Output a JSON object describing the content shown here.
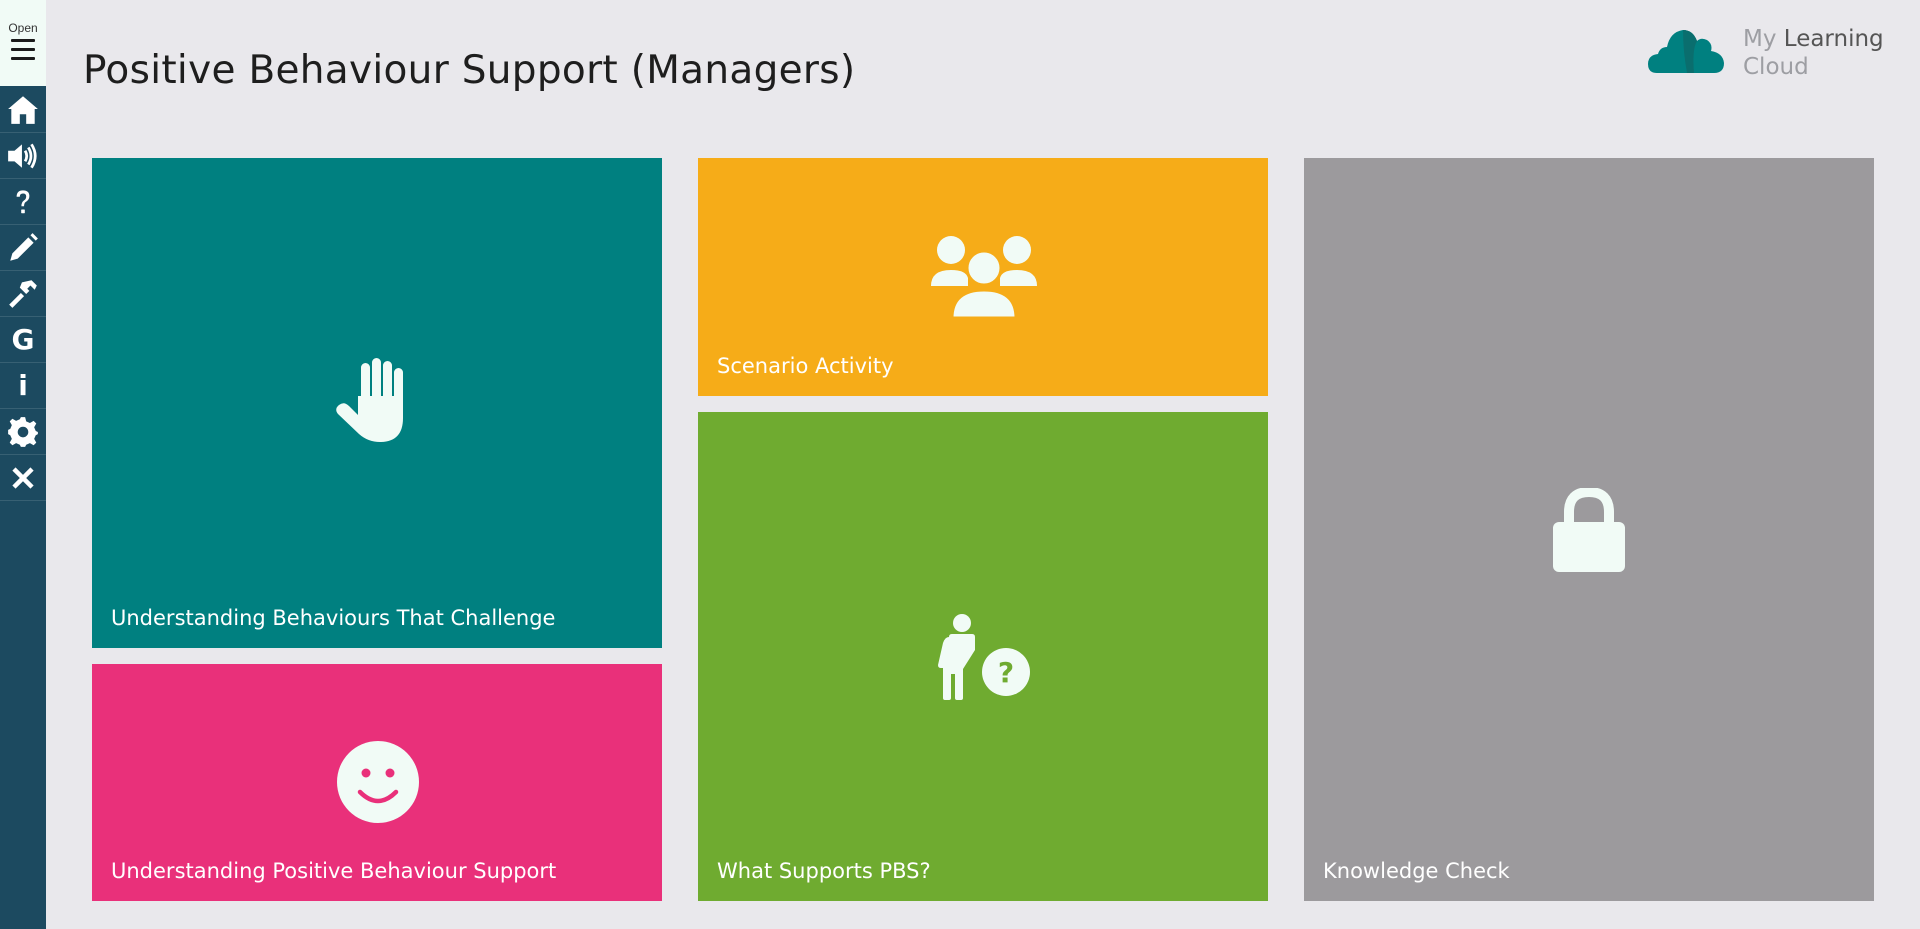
{
  "page": {
    "title": "Positive Behaviour Support (Managers)"
  },
  "logo": {
    "text_light": "My",
    "text_bold": "Learning",
    "text_line2": "Cloud",
    "color": "#008080"
  },
  "sidebar": {
    "toggle_label": "Open",
    "items": [
      {
        "name": "home",
        "icon": "home-icon"
      },
      {
        "name": "audio",
        "icon": "speaker-icon"
      },
      {
        "name": "help",
        "icon": "question-icon"
      },
      {
        "name": "notes",
        "icon": "pencil-icon"
      },
      {
        "name": "tools",
        "icon": "hammer-icon"
      },
      {
        "name": "glossary",
        "icon": "g-icon",
        "glyph": "G"
      },
      {
        "name": "info",
        "icon": "info-icon",
        "glyph": "i"
      },
      {
        "name": "settings",
        "icon": "gear-icon"
      },
      {
        "name": "close",
        "icon": "close-icon"
      }
    ],
    "background": "#1c4a60"
  },
  "tiles": [
    {
      "id": "understanding-behaviours",
      "label": "Understanding Behaviours That Challenge",
      "icon": "hand-icon",
      "color": "#008080"
    },
    {
      "id": "understanding-pbs",
      "label": "Understanding Positive Behaviour Support",
      "icon": "smiley-icon",
      "color": "#e9307a"
    },
    {
      "id": "scenario-activity",
      "label": "Scenario Activity",
      "icon": "group-icon",
      "color": "#f6ac18"
    },
    {
      "id": "what-supports-pbs",
      "label": "What Supports PBS?",
      "icon": "person-question-icon",
      "color": "#6fab30"
    },
    {
      "id": "knowledge-check",
      "label": "Knowledge Check",
      "icon": "lock-icon",
      "color": "#9c9a9d"
    }
  ]
}
